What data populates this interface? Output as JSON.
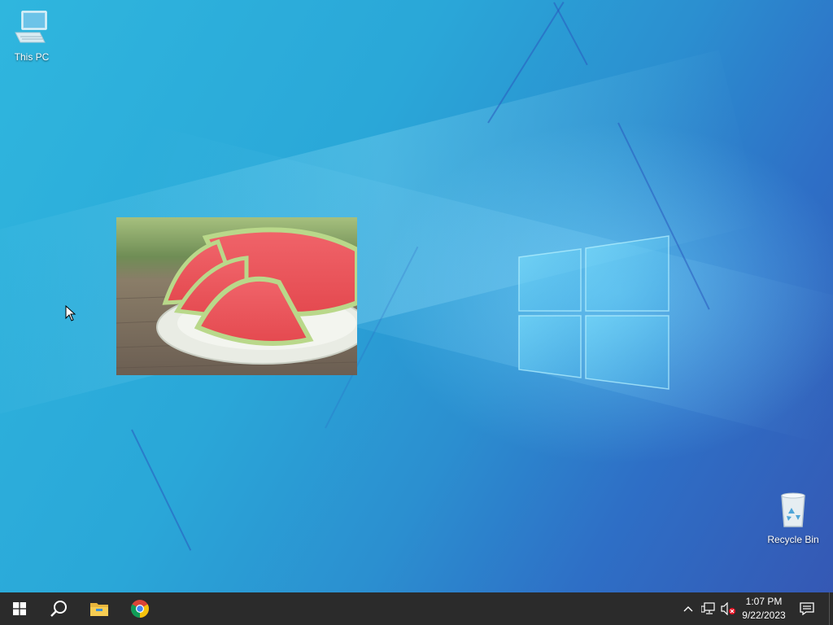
{
  "desktop": {
    "icons": [
      {
        "label": "This PC",
        "icon": "computer-icon"
      },
      {
        "label": "Recycle Bin",
        "icon": "recycle-bin-icon"
      }
    ],
    "photo": {
      "subject": "watermelon"
    }
  },
  "taskbar": {
    "apps": [
      {
        "icon": "windows-start-icon"
      },
      {
        "icon": "search-icon"
      },
      {
        "icon": "file-explorer-icon"
      },
      {
        "icon": "chrome-icon"
      }
    ],
    "tray": {
      "icons": [
        "chevron-up-icon",
        "network-icon",
        "volume-muted-icon",
        "notification-icon"
      ]
    },
    "clock": {
      "time": "1:07 PM",
      "date": "9/22/2023"
    }
  },
  "colors": {
    "taskbar": "#2b2b2b",
    "desktop_primary": "#2aa7d8",
    "desktop_secondary": "#3558b4"
  }
}
